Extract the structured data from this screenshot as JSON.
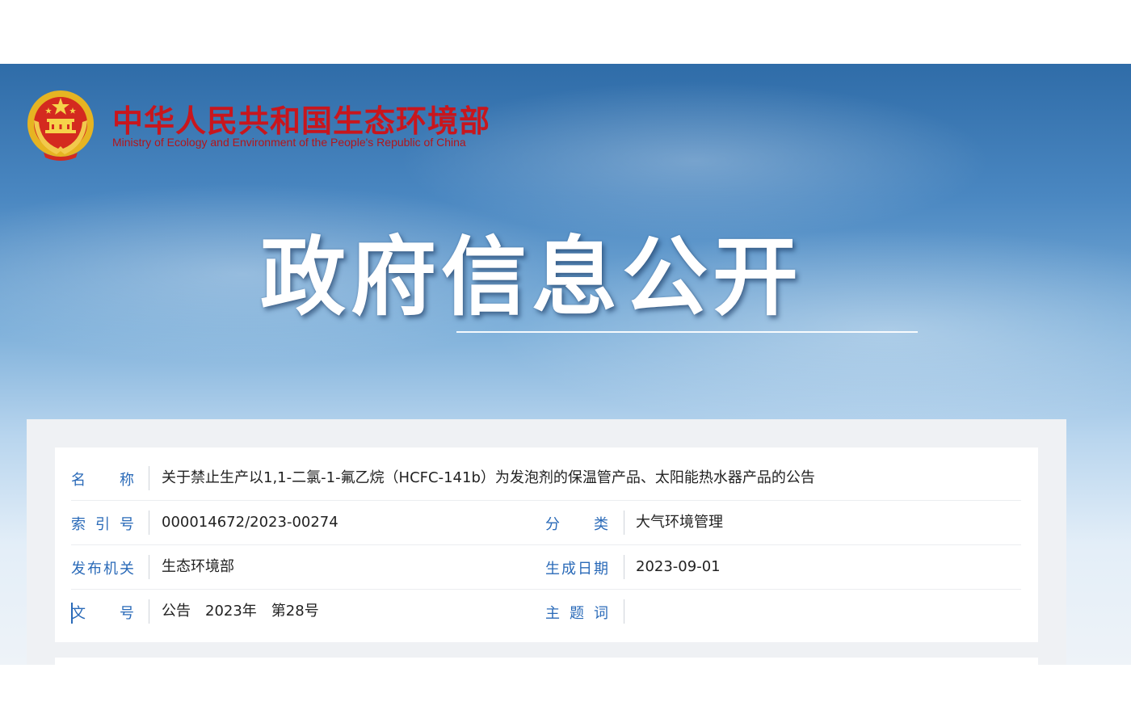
{
  "header": {
    "ministry_name_cn": "中华人民共和国生态环境部",
    "ministry_name_en": "Ministry of Ecology and Environment of the People's Republic of China",
    "banner_title": "政府信息公开"
  },
  "colors": {
    "brand_red": "#c8161d",
    "label_blue": "#2a6ab8",
    "banner_sky": "#4a87c1"
  },
  "fields": {
    "name": {
      "label_chars": [
        "名",
        "称"
      ],
      "value": "关于禁止生产以1,1-二氯-1-氟乙烷（HCFC-141b）为发泡剂的保温管产品、太阳能热水器产品的公告"
    },
    "index_no": {
      "label_chars": [
        "索",
        "引",
        "号"
      ],
      "value": "000014672/2023-00274"
    },
    "category": {
      "label_chars": [
        "分",
        "类"
      ],
      "value": "大气环境管理"
    },
    "publisher": {
      "label_chars": [
        "发",
        "布",
        "机",
        "关"
      ],
      "value": "生态环境部"
    },
    "created_date": {
      "label_chars": [
        "生",
        "成",
        "日",
        "期"
      ],
      "value": "2023-09-01"
    },
    "doc_no": {
      "label_chars": [
        "文",
        "号"
      ],
      "value": "公告　2023年　第28号"
    },
    "keywords": {
      "label_chars": [
        "主",
        "题",
        "词"
      ],
      "value": ""
    }
  }
}
